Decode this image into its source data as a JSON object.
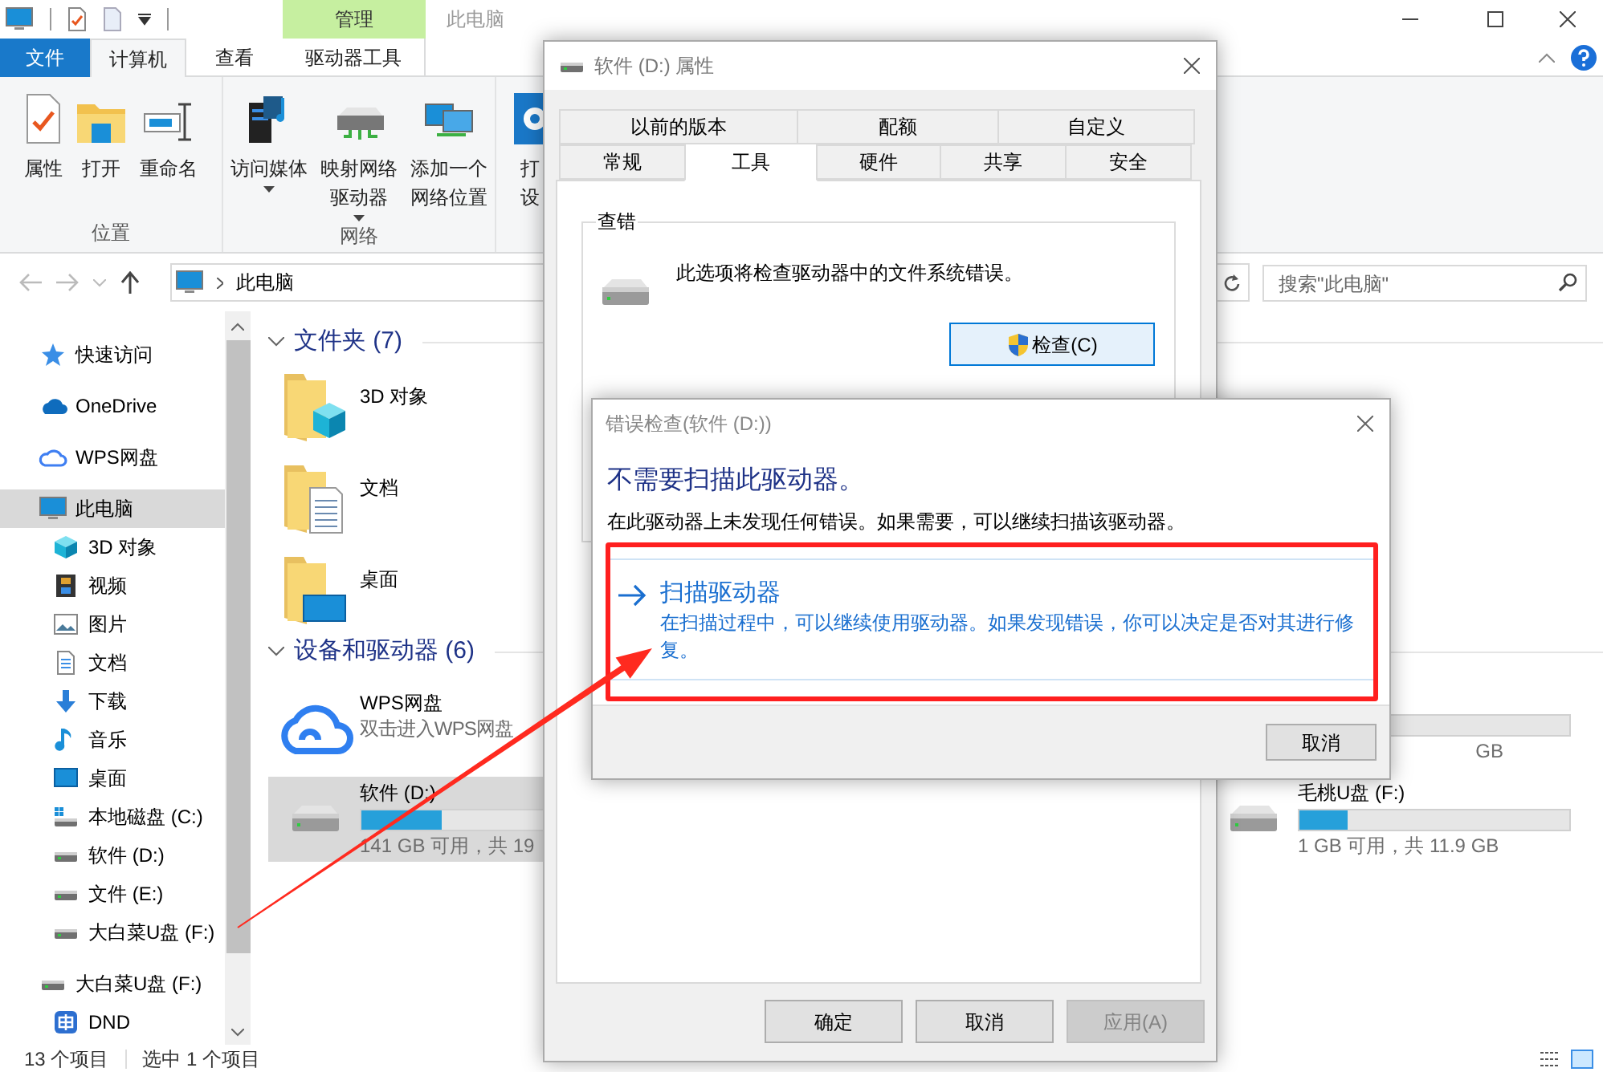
{
  "explorer": {
    "title": "此电脑",
    "context_tab": "管理",
    "ribbon_tabs": [
      {
        "label": "文件",
        "kind": "file",
        "selected": false
      },
      {
        "label": "计算机",
        "kind": "tab",
        "selected": true
      },
      {
        "label": "查看",
        "kind": "tab",
        "selected": false
      },
      {
        "label": "驱动器工具",
        "kind": "context",
        "selected": false
      }
    ],
    "ribbon_groups": [
      {
        "label": "位置",
        "commands": [
          {
            "kind": "properties",
            "lines": [
              "属性"
            ],
            "dropdown": false
          },
          {
            "kind": "open",
            "lines": [
              "打开"
            ],
            "dropdown": false
          },
          {
            "kind": "rename",
            "lines": [
              "重命名"
            ],
            "dropdown": false
          }
        ]
      },
      {
        "label": "网络",
        "commands": [
          {
            "kind": "media",
            "lines": [
              "访问媒体"
            ],
            "dropdown": true
          },
          {
            "kind": "map-drive",
            "lines": [
              "映射网络",
              "驱动器"
            ],
            "dropdown": true
          },
          {
            "kind": "network-location",
            "lines": [
              "添加一个",
              "网络位置"
            ],
            "dropdown": false
          }
        ]
      },
      {
        "commands": [
          {
            "kind": "settings",
            "lines": [
              "打",
              "设"
            ],
            "dropdown": false
          }
        ]
      }
    ],
    "address": {
      "path": "此电脑"
    },
    "search": {
      "placeholder": "搜索\"此电脑\""
    },
    "navigation": [
      {
        "label": "快速访问",
        "kind": "star",
        "selected": false
      },
      {
        "label": "OneDrive",
        "kind": "cloud-solid",
        "selected": false
      },
      {
        "label": "WPS网盘",
        "kind": "cloud-outline",
        "selected": false
      },
      {
        "label": "此电脑",
        "kind": "computer",
        "selected": true,
        "children": [
          {
            "label": "3D 对象",
            "kind": "cube",
            "selected": false
          },
          {
            "label": "视频",
            "kind": "film",
            "selected": false
          },
          {
            "label": "图片",
            "kind": "image",
            "selected": false
          },
          {
            "label": "文档",
            "kind": "document",
            "selected": false
          },
          {
            "label": "下载",
            "kind": "download",
            "selected": false
          },
          {
            "label": "音乐",
            "kind": "music",
            "selected": false
          },
          {
            "label": "桌面",
            "kind": "desktop",
            "selected": false
          },
          {
            "label": "本地磁盘 (C:)",
            "kind": "system-drive",
            "selected": false
          },
          {
            "label": "软件 (D:)",
            "kind": "drive",
            "selected": false
          },
          {
            "label": "文件 (E:)",
            "kind": "drive",
            "selected": false
          },
          {
            "label": "大白菜U盘 (F:)",
            "kind": "drive",
            "selected": false
          }
        ]
      },
      {
        "label": "大白菜U盘 (F:)",
        "kind": "drive",
        "selected": false,
        "children": [
          {
            "label": "DND",
            "kind": "app",
            "selected": false
          }
        ]
      }
    ],
    "sections": [
      {
        "title": "文件夹 (7)",
        "expanded": true,
        "rows": [
          {
            "cells": [
              {
                "kind": "folder-cube",
                "name": "3D 对象",
                "selected": false
              }
            ]
          },
          {
            "cells": [
              {
                "kind": "folder-document",
                "name": "文档",
                "selected": false
              }
            ]
          },
          {
            "cells": [
              {
                "kind": "folder-screen",
                "name": "桌面",
                "selected": false
              }
            ]
          }
        ]
      },
      {
        "title": "设备和驱动器 (6)",
        "expanded": true,
        "rows": [
          {
            "cells": [
              {
                "kind": "cloud",
                "name": "WPS网盘",
                "detail": "双击进入WPS网盘",
                "selected": false
              },
              {
                "kind": "drive",
                "detail": "GB",
                "selected": false
              }
            ]
          },
          {
            "cells": [
              {
                "kind": "drive",
                "name": "软件 (D:)",
                "level": 0.3,
                "detail": "141 GB 可用，共 19",
                "selected": true
              },
              {
                "kind": "drive",
                "name": "毛桃U盘 (F:)",
                "level": 0.18,
                "detail": "1 GB 可用，共 11.9 GB",
                "selected": false
              }
            ]
          }
        ]
      }
    ],
    "status_bar": {
      "item_count": "13 个项目",
      "selection": "选中 1 个项目"
    }
  },
  "properties_dialog": {
    "title": "软件 (D:) 属性",
    "tab_rows": [
      [
        {
          "label": "以前的版本",
          "selected": false
        },
        {
          "label": "配额",
          "selected": false
        },
        {
          "label": "自定义",
          "selected": false
        }
      ],
      [
        {
          "label": "常规",
          "selected": false
        },
        {
          "label": "工具",
          "selected": true
        },
        {
          "label": "硬件",
          "selected": false
        },
        {
          "label": "共享",
          "selected": false
        },
        {
          "label": "安全",
          "selected": false
        }
      ]
    ],
    "group": {
      "title": "查错",
      "description": "此选项将检查驱动器中的文件系统错误。",
      "button": "检查(C)"
    },
    "buttons": [
      {
        "label": "确定",
        "disabled": false
      },
      {
        "label": "取消",
        "disabled": false
      },
      {
        "label": "应用(A)",
        "disabled": true
      }
    ]
  },
  "error_check_dialog": {
    "title": "错误检查(软件 (D:))",
    "heading": "不需要扫描此驱动器。",
    "message": "在此驱动器上未发现任何错误。如果需要，可以继续扫描该驱动器。",
    "option": {
      "title": "扫描驱动器",
      "description": "在扫描过程中，可以继续使用驱动器。如果发现错误，你可以决定是否对其进行修复。"
    },
    "cancel": "取消"
  }
}
